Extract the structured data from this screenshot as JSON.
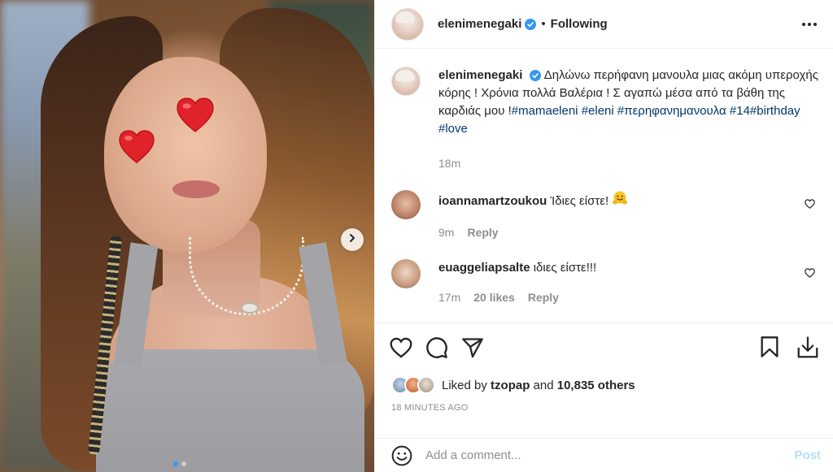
{
  "post": {
    "author": "elenimenegaki",
    "follow_separator": "•",
    "follow_status": "Following",
    "caption": {
      "text_1": "Δηλώνω περήφανη μανουλα μιας ακόμη υπεροχής κόρης ! Χρόνια πολλά Βαλέρια ! Σ αγαπώ μέσα από τα βάθη της καρδιάς μου !",
      "hashtags": [
        "#mamaeleni",
        "#eleni",
        "#περηφανημανουλα",
        "#14",
        "#birthday",
        "#love"
      ],
      "time": "18m"
    },
    "comments": [
      {
        "user": "ioannamartzoukou",
        "text": "Ίδιες είστε!",
        "emoji": "hugging-face",
        "time": "9m",
        "likes": "",
        "reply_label": "Reply"
      },
      {
        "user": "euaggeliapsalte",
        "text": "ιδιες είστε!!!",
        "emoji": "",
        "time": "17m",
        "likes": "20 likes",
        "reply_label": "Reply"
      }
    ],
    "liked_by_prefix": "Liked by",
    "liked_by_user": "tzopap",
    "liked_by_and": "and",
    "liked_by_others": "10,835 others",
    "timestamp": "18 MINUTES AGO",
    "add_comment_placeholder": "Add a comment...",
    "post_label": "Post"
  },
  "carousel": {
    "slide_count": 2,
    "current_slide": 1
  },
  "colors": {
    "hashtag": "#00376b",
    "verified": "#3897f0",
    "post_disabled": "#b2dffc",
    "heart": "#e0222b"
  },
  "icons": [
    "verified-badge-icon",
    "more-options-icon",
    "heart-icon",
    "comment-icon",
    "share-icon",
    "bookmark-icon",
    "download-icon",
    "emoji-icon",
    "chevron-right-icon"
  ]
}
